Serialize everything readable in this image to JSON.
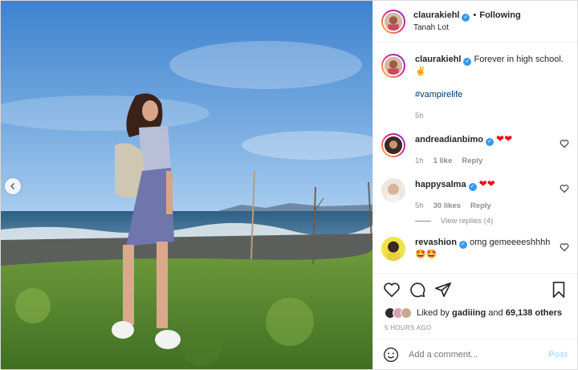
{
  "header": {
    "username": "claurakiehl",
    "separator": "•",
    "follow_state": "Following",
    "location": "Tanah Lot"
  },
  "caption": {
    "username": "claurakiehl",
    "text": "Forever in high school. ✌",
    "hashtag": "#vampirelife",
    "age": "5h"
  },
  "comments": [
    {
      "username": "andreadianbimo",
      "text": "❤❤",
      "age": "1h",
      "likes": "1 like",
      "reply": "Reply"
    },
    {
      "username": "happysalma",
      "text": "❤❤",
      "age": "5h",
      "likes": "30 likes",
      "reply": "Reply",
      "view_replies": "View replies (4)"
    },
    {
      "username": "revashion",
      "text": "omg gemeeeeshhhh",
      "emoji": "🤩🤩"
    }
  ],
  "likes": {
    "prefix": "Liked by",
    "user": "gadiiing",
    "joiner": "and",
    "others": "69,138 others"
  },
  "time_ago": "5 HOURS AGO",
  "composer": {
    "placeholder": "Add a comment...",
    "post_label": "Post"
  },
  "colors": {
    "accent_blue": "#3897f0",
    "hashtag_blue": "#00376b",
    "heart_red": "#e0141e",
    "post_disabled": "#b2dffc",
    "muted": "#8e8e8e"
  },
  "icons": [
    "chevron-left-icon",
    "verified-badge-icon",
    "heart-icon",
    "comment-icon",
    "share-icon",
    "bookmark-icon",
    "smiley-icon"
  ]
}
